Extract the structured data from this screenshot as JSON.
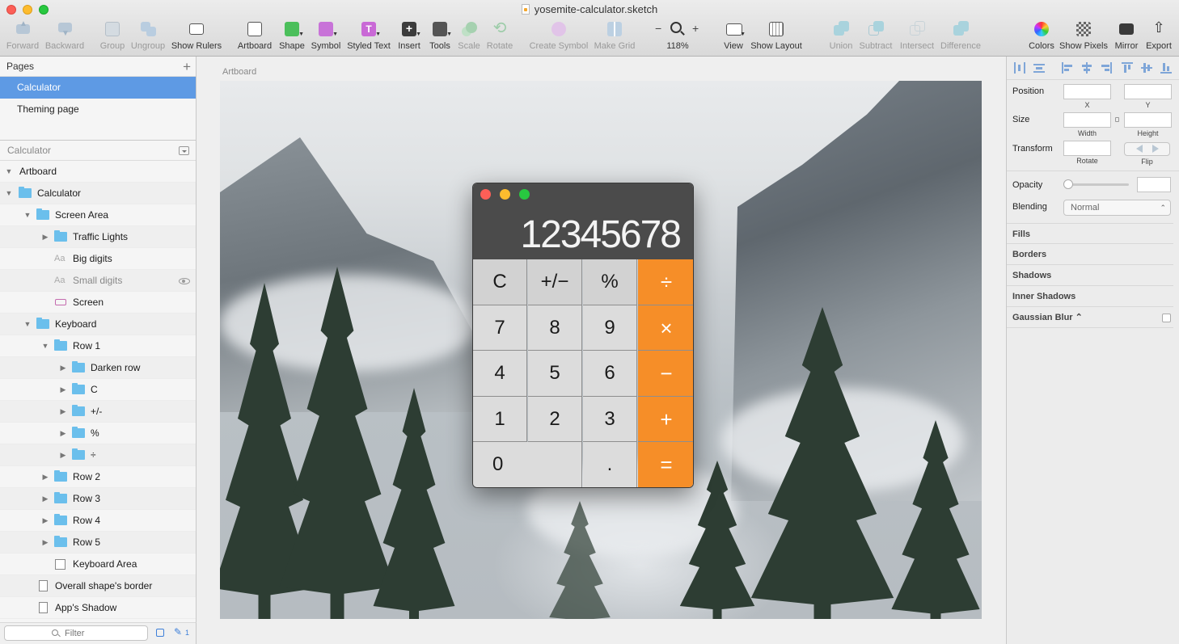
{
  "window": {
    "title": "yosemite-calculator.sketch"
  },
  "toolbar": {
    "forward": "Forward",
    "backward": "Backward",
    "group": "Group",
    "ungroup": "Ungroup",
    "show_rulers": "Show Rulers",
    "artboard": "Artboard",
    "shape": "Shape",
    "symbol": "Symbol",
    "styled_text": "Styled Text",
    "insert": "Insert",
    "tools": "Tools",
    "scale": "Scale",
    "rotate": "Rotate",
    "create_symbol": "Create Symbol",
    "make_grid": "Make Grid",
    "zoom_minus": "−",
    "zoom_plus": "+",
    "zoom_level": "118%",
    "view": "View",
    "show_layout": "Show Layout",
    "union": "Union",
    "subtract": "Subtract",
    "intersect": "Intersect",
    "difference": "Difference",
    "colors": "Colors",
    "show_pixels": "Show Pixels",
    "mirror": "Mirror",
    "export": "Export"
  },
  "pages": {
    "header": "Pages",
    "items": [
      "Calculator",
      "Theming page"
    ],
    "selected": "Calculator"
  },
  "layers": {
    "header": "Calculator",
    "items": [
      {
        "label": "Artboard",
        "indent": 0,
        "icon": "none",
        "expanded": true
      },
      {
        "label": "Calculator",
        "indent": 0,
        "icon": "folder",
        "expanded": true
      },
      {
        "label": "Screen Area",
        "indent": 1,
        "icon": "folder",
        "expanded": true
      },
      {
        "label": "Traffic Lights",
        "indent": 2,
        "icon": "folder",
        "expanded": false
      },
      {
        "label": "Big digits",
        "indent": 2,
        "icon": "text"
      },
      {
        "label": "Small digits",
        "indent": 2,
        "icon": "text",
        "hidden": true
      },
      {
        "label": "Screen",
        "indent": 2,
        "icon": "rect"
      },
      {
        "label": "Keyboard",
        "indent": 1,
        "icon": "folder",
        "expanded": true
      },
      {
        "label": "Row 1",
        "indent": 2,
        "icon": "folder",
        "expanded": true
      },
      {
        "label": "Darken row",
        "indent": 3,
        "icon": "folder",
        "expanded": false
      },
      {
        "label": "C",
        "indent": 3,
        "icon": "folder",
        "expanded": false
      },
      {
        "label": "+/-",
        "indent": 3,
        "icon": "folder",
        "expanded": false
      },
      {
        "label": "%",
        "indent": 3,
        "icon": "folder",
        "expanded": false
      },
      {
        "label": "÷",
        "indent": 3,
        "icon": "folder",
        "expanded": false
      },
      {
        "label": "Row 2",
        "indent": 2,
        "icon": "folder",
        "expanded": false
      },
      {
        "label": "Row 3",
        "indent": 2,
        "icon": "folder",
        "expanded": false
      },
      {
        "label": "Row 4",
        "indent": 2,
        "icon": "folder",
        "expanded": false
      },
      {
        "label": "Row 5",
        "indent": 2,
        "icon": "folder",
        "expanded": false
      },
      {
        "label": "Keyboard Area",
        "indent": 2,
        "icon": "square"
      },
      {
        "label": "Overall shape's border",
        "indent": 1,
        "icon": "page"
      },
      {
        "label": "App's Shadow",
        "indent": 1,
        "icon": "page"
      }
    ],
    "filter_placeholder": "Filter",
    "edit_count": "1"
  },
  "canvas": {
    "artboard_label": "Artboard"
  },
  "calculator": {
    "display": "12345678",
    "keys": [
      {
        "label": "C",
        "kind": "top"
      },
      {
        "label": "+/−",
        "kind": "top"
      },
      {
        "label": "%",
        "kind": "top"
      },
      {
        "label": "÷",
        "kind": "op"
      },
      {
        "label": "7",
        "kind": "num"
      },
      {
        "label": "8",
        "kind": "num"
      },
      {
        "label": "9",
        "kind": "num"
      },
      {
        "label": "×",
        "kind": "op"
      },
      {
        "label": "4",
        "kind": "num"
      },
      {
        "label": "5",
        "kind": "num"
      },
      {
        "label": "6",
        "kind": "num"
      },
      {
        "label": "−",
        "kind": "op"
      },
      {
        "label": "1",
        "kind": "num"
      },
      {
        "label": "2",
        "kind": "num"
      },
      {
        "label": "3",
        "kind": "num"
      },
      {
        "label": "+",
        "kind": "op"
      },
      {
        "label": "0",
        "kind": "zero"
      },
      {
        "label": ".",
        "kind": "num"
      },
      {
        "label": "=",
        "kind": "op"
      }
    ],
    "accent_color": "#f68e28"
  },
  "inspector": {
    "position": "Position",
    "x": "X",
    "y": "Y",
    "size": "Size",
    "width": "Width",
    "height": "Height",
    "transform": "Transform",
    "rotate": "Rotate",
    "flip": "Flip",
    "opacity": "Opacity",
    "blending": "Blending",
    "blending_value": "Normal",
    "sections": [
      "Fills",
      "Borders",
      "Shadows",
      "Inner Shadows",
      "Gaussian Blur ⌃"
    ]
  },
  "colors": {
    "selection": "#5e9ae4",
    "folder": "#6bbfec"
  }
}
